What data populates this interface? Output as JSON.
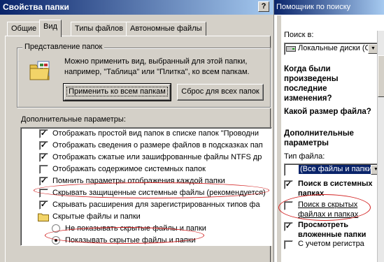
{
  "dialog": {
    "title": "Свойства папки",
    "help_glyph": "?",
    "tabs": [
      {
        "label": "Общие"
      },
      {
        "label": "Вид"
      },
      {
        "label": "Типы файлов"
      },
      {
        "label": "Автономные файлы"
      }
    ],
    "folder_view": {
      "group_title": "Представление папок",
      "description": "Можно применить вид, выбранный для этой папки, например, \"Таблица\" или \"Плитка\", ко всем папкам.",
      "apply_all_label": "Применить ко всем папкам",
      "reset_all_label": "Сброс для всех папок"
    },
    "advanced": {
      "label": "Дополнительные параметры:",
      "items": [
        {
          "text": "Отображать простой вид папок в списке папок \"Проводни",
          "checked": true,
          "type": "check"
        },
        {
          "text": "Отображать сведения о размере файлов в подсказках пап",
          "checked": true,
          "type": "check"
        },
        {
          "text": "Отображать сжатые или зашифрованные файлы NTFS др",
          "checked": true,
          "type": "check"
        },
        {
          "text": "Отображать содержимое системных папок",
          "checked": false,
          "type": "check"
        },
        {
          "text": "Помнить параметры отображения каждой папки",
          "checked": true,
          "type": "check"
        },
        {
          "text": "Скрывать защищенные системные файлы (рекомендуется)",
          "checked": false,
          "type": "check"
        },
        {
          "text": "Скрывать расширения для зарегистрированных типов фа",
          "checked": true,
          "type": "check"
        },
        {
          "text": "Скрытые файлы и папки",
          "type": "folder"
        },
        {
          "text": "Не показывать скрытые файлы и папки",
          "checked": false,
          "type": "radio"
        },
        {
          "text": "Показывать скрытые файлы и папки",
          "checked": true,
          "type": "radio"
        }
      ]
    }
  },
  "search_pane": {
    "title": "Помощник по поиску",
    "search_in_label": "Поиск в:",
    "search_in_value": "Локальные диски (С",
    "when_modified": "Когда были произведены последние изменения?",
    "size_question": "Какой размер файла?",
    "advanced_params": "Дополнительные параметры",
    "file_type_label": "Тип файла:",
    "file_type_value": "(Все файлы и папки",
    "options": [
      {
        "text": "Поиск в системных папках",
        "checked": true
      },
      {
        "text": "Поиск в скрытых файлах и папках",
        "checked": false
      },
      {
        "text": "Просмотреть вложенные папки",
        "checked": true
      },
      {
        "text": "С учетом регистра",
        "checked": false
      }
    ],
    "chevron_down": "▼",
    "chevron_up": "▲"
  },
  "colors": {
    "title_start": "#0a246a",
    "title_end": "#a6caf0",
    "face": "#d4d0c8",
    "annotation": "#d22020"
  }
}
